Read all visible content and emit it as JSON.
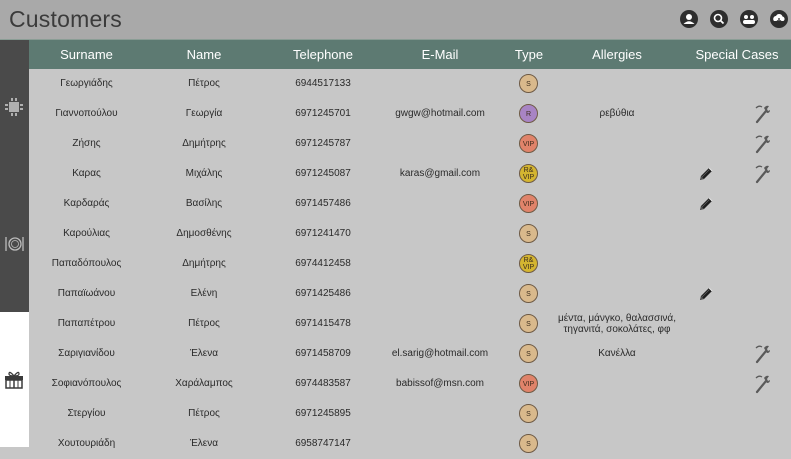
{
  "app": {
    "title": "Customers"
  },
  "toolbar": {
    "icons": [
      "account-icon",
      "search-icon",
      "group-icon",
      "cloud-download-icon"
    ]
  },
  "sidebar": {
    "icons": [
      "table-icon",
      "dining-icon",
      "gift-icon"
    ]
  },
  "table": {
    "headers": {
      "surname": "Surname",
      "name": "Name",
      "telephone": "Telephone",
      "email": "E-Mail",
      "type": "Type",
      "allergies": "Allergies",
      "special": "Special Cases"
    },
    "type_colors": {
      "S": "#d9b98c",
      "R": "#a884c4",
      "VIP": "#e0836a",
      "R&VIP": "#d4b531"
    },
    "rows": [
      {
        "surname": "Γεωργιάδης",
        "name": "Πέτρος",
        "telephone": "6944517133",
        "email": "",
        "type": "S",
        "type_top": "",
        "type_bottom": "",
        "allergies": "",
        "note": false,
        "special": false
      },
      {
        "surname": "Γιαννοπούλου",
        "name": "Γεωργία",
        "telephone": "6971245701",
        "email": "gwgw@hotmail.com",
        "type": "R",
        "type_top": "",
        "type_bottom": "",
        "allergies": "ρεβύθια",
        "note": false,
        "special": true
      },
      {
        "surname": "Ζήσης",
        "name": "Δημήτρης",
        "telephone": "6971245787",
        "email": "",
        "type": "VIP",
        "type_top": "",
        "type_bottom": "",
        "allergies": "",
        "note": false,
        "special": true
      },
      {
        "surname": "Καρας",
        "name": "Μιχάλης",
        "telephone": "6971245087",
        "email": "karas@gmail.com",
        "type": "R&VIP",
        "type_top": "R&",
        "type_bottom": "VIP",
        "allergies": "",
        "note": true,
        "special": true
      },
      {
        "surname": "Καρδαράς",
        "name": "Βασίλης",
        "telephone": "6971457486",
        "email": "",
        "type": "VIP",
        "type_top": "",
        "type_bottom": "",
        "allergies": "",
        "note": true,
        "special": false
      },
      {
        "surname": "Καρούλιας",
        "name": "Δημοσθένης",
        "telephone": "6971241470",
        "email": "",
        "type": "S",
        "type_top": "",
        "type_bottom": "",
        "allergies": "",
        "note": false,
        "special": false
      },
      {
        "surname": "Παπαδόπουλος",
        "name": "Δημήτρης",
        "telephone": "6974412458",
        "email": "",
        "type": "R&VIP",
        "type_top": "R&",
        "type_bottom": "VIP",
        "allergies": "",
        "note": false,
        "special": false
      },
      {
        "surname": "Παπαϊωάνου",
        "name": "Ελένη",
        "telephone": "6971425486",
        "email": "",
        "type": "S",
        "type_top": "",
        "type_bottom": "",
        "allergies": "",
        "note": true,
        "special": false
      },
      {
        "surname": "Παπαπέτρου",
        "name": "Πέτρος",
        "telephone": "6971415478",
        "email": "",
        "type": "S",
        "type_top": "",
        "type_bottom": "",
        "allergies": "μέντα, μάνγκο, θαλασσινά, τηγανιτά, σοκολάτες, φφ",
        "note": false,
        "special": false
      },
      {
        "surname": "Σαριγιανίδου",
        "name": "Έλενα",
        "telephone": "6971458709",
        "email": "el.sarig@hotmail.com",
        "type": "S",
        "type_top": "",
        "type_bottom": "",
        "allergies": "Κανέλλα",
        "note": false,
        "special": true
      },
      {
        "surname": "Σοφιανόπουλος",
        "name": "Χαράλαμπος",
        "telephone": "6974483587",
        "email": "babissof@msn.com",
        "type": "VIP",
        "type_top": "",
        "type_bottom": "",
        "allergies": "",
        "note": false,
        "special": true
      },
      {
        "surname": "Στεργίου",
        "name": "Πέτρος",
        "telephone": "6971245895",
        "email": "",
        "type": "S",
        "type_top": "",
        "type_bottom": "",
        "allergies": "",
        "note": false,
        "special": false
      },
      {
        "surname": "Χουτουριάδη",
        "name": "Έλενα",
        "telephone": "6958747147",
        "email": "",
        "type": "S",
        "type_top": "",
        "type_bottom": "",
        "allergies": "",
        "note": false,
        "special": false
      }
    ]
  }
}
